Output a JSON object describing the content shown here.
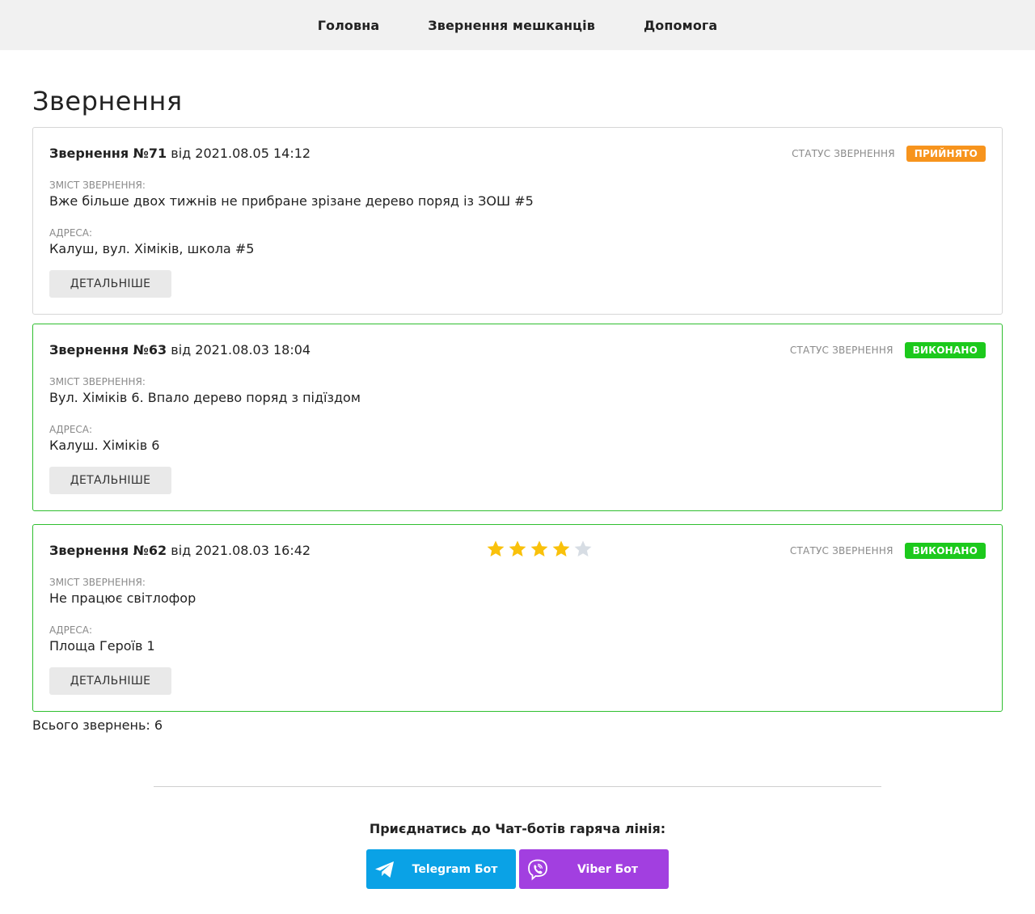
{
  "nav": {
    "home": "Головна",
    "requests": "Звернення мешканців",
    "help": "Допомога"
  },
  "page_title": "Звернення",
  "labels": {
    "status": "СТАТУС ЗВЕРНЕННЯ",
    "content": "ЗМІСТ ЗВЕРНЕННЯ:",
    "address": "АДРЕСА:",
    "details": "ДЕТАЛЬНІШЕ",
    "from": "від"
  },
  "requests": [
    {
      "title": "Звернення №71",
      "date": "2021.08.05 14:12",
      "status": "ПРИЙНЯТО",
      "status_color": "#f7941d",
      "content": "Вже більше двох тижнів не прибране зрізане дерево поряд із ЗОШ #5",
      "address": "Калуш, вул. Хіміків, школа #5"
    },
    {
      "title": "Звернення №63",
      "date": "2021.08.03 18:04",
      "status": "ВИКОНАНО",
      "status_color": "#1cc91c",
      "content": "Вул. Хіміків 6. Впало дерево поряд з підїздом",
      "address": "Калуш. Хіміків 6"
    },
    {
      "title": "Звернення №62",
      "date": "2021.08.03 16:42",
      "status": "ВИКОНАНО",
      "status_color": "#1cc91c",
      "rating": 4,
      "rating_max": 5,
      "content": "Не працює світлофор",
      "address": "Площа Героїв 1"
    }
  ],
  "total": "Всього звернень: 6",
  "footer": {
    "title": "Приєднатись до Чат-ботів гаряча лінія:",
    "telegram": "Telegram Бот",
    "viber": "Viber Бот",
    "telegram_color": "#0aa2e6",
    "viber_color": "#a23fe0"
  }
}
